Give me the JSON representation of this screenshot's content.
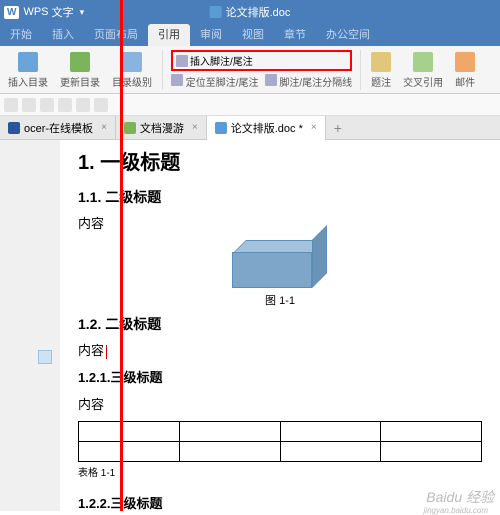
{
  "titlebar": {
    "app_prefix": "WPS",
    "app_name": "文字",
    "doc_title": "论文排版.doc"
  },
  "menu": [
    "开始",
    "插入",
    "页面布局",
    "引用",
    "审阅",
    "视图",
    "章节",
    "办公空间"
  ],
  "menu_active_index": 3,
  "ribbon": {
    "btn1": "插入目录",
    "btn2": "更新目录",
    "btn3": "目录级别",
    "insert_footnote_label": "插入脚注/尾注",
    "locate": "定位至脚注/尾注",
    "separator": "脚注/尾注分隔线",
    "caption_btn": "题注",
    "crossref": "交叉引用",
    "mail": "邮件"
  },
  "tabs": [
    {
      "label": "ocer-在线模板",
      "icon": "blue"
    },
    {
      "label": "文档漫游",
      "icon": "cloud"
    },
    {
      "label": "论文排版.doc *",
      "icon": "word",
      "active": true
    }
  ],
  "doc": {
    "h1": "1. 一级标题",
    "h2_1": "1.1. 二级标题",
    "content": "内容",
    "fig_caption": "图  1-1",
    "h2_2": "1.2. 二级标题",
    "h3_1": "1.2.1.三级标题",
    "table_caption": "表格  1-1",
    "h3_2": "1.2.2.三级标题"
  },
  "watermark": {
    "main": "Baidu 经验",
    "sub": "jingyan.baidu.com"
  },
  "annotation": {
    "highlight_color": "red"
  }
}
